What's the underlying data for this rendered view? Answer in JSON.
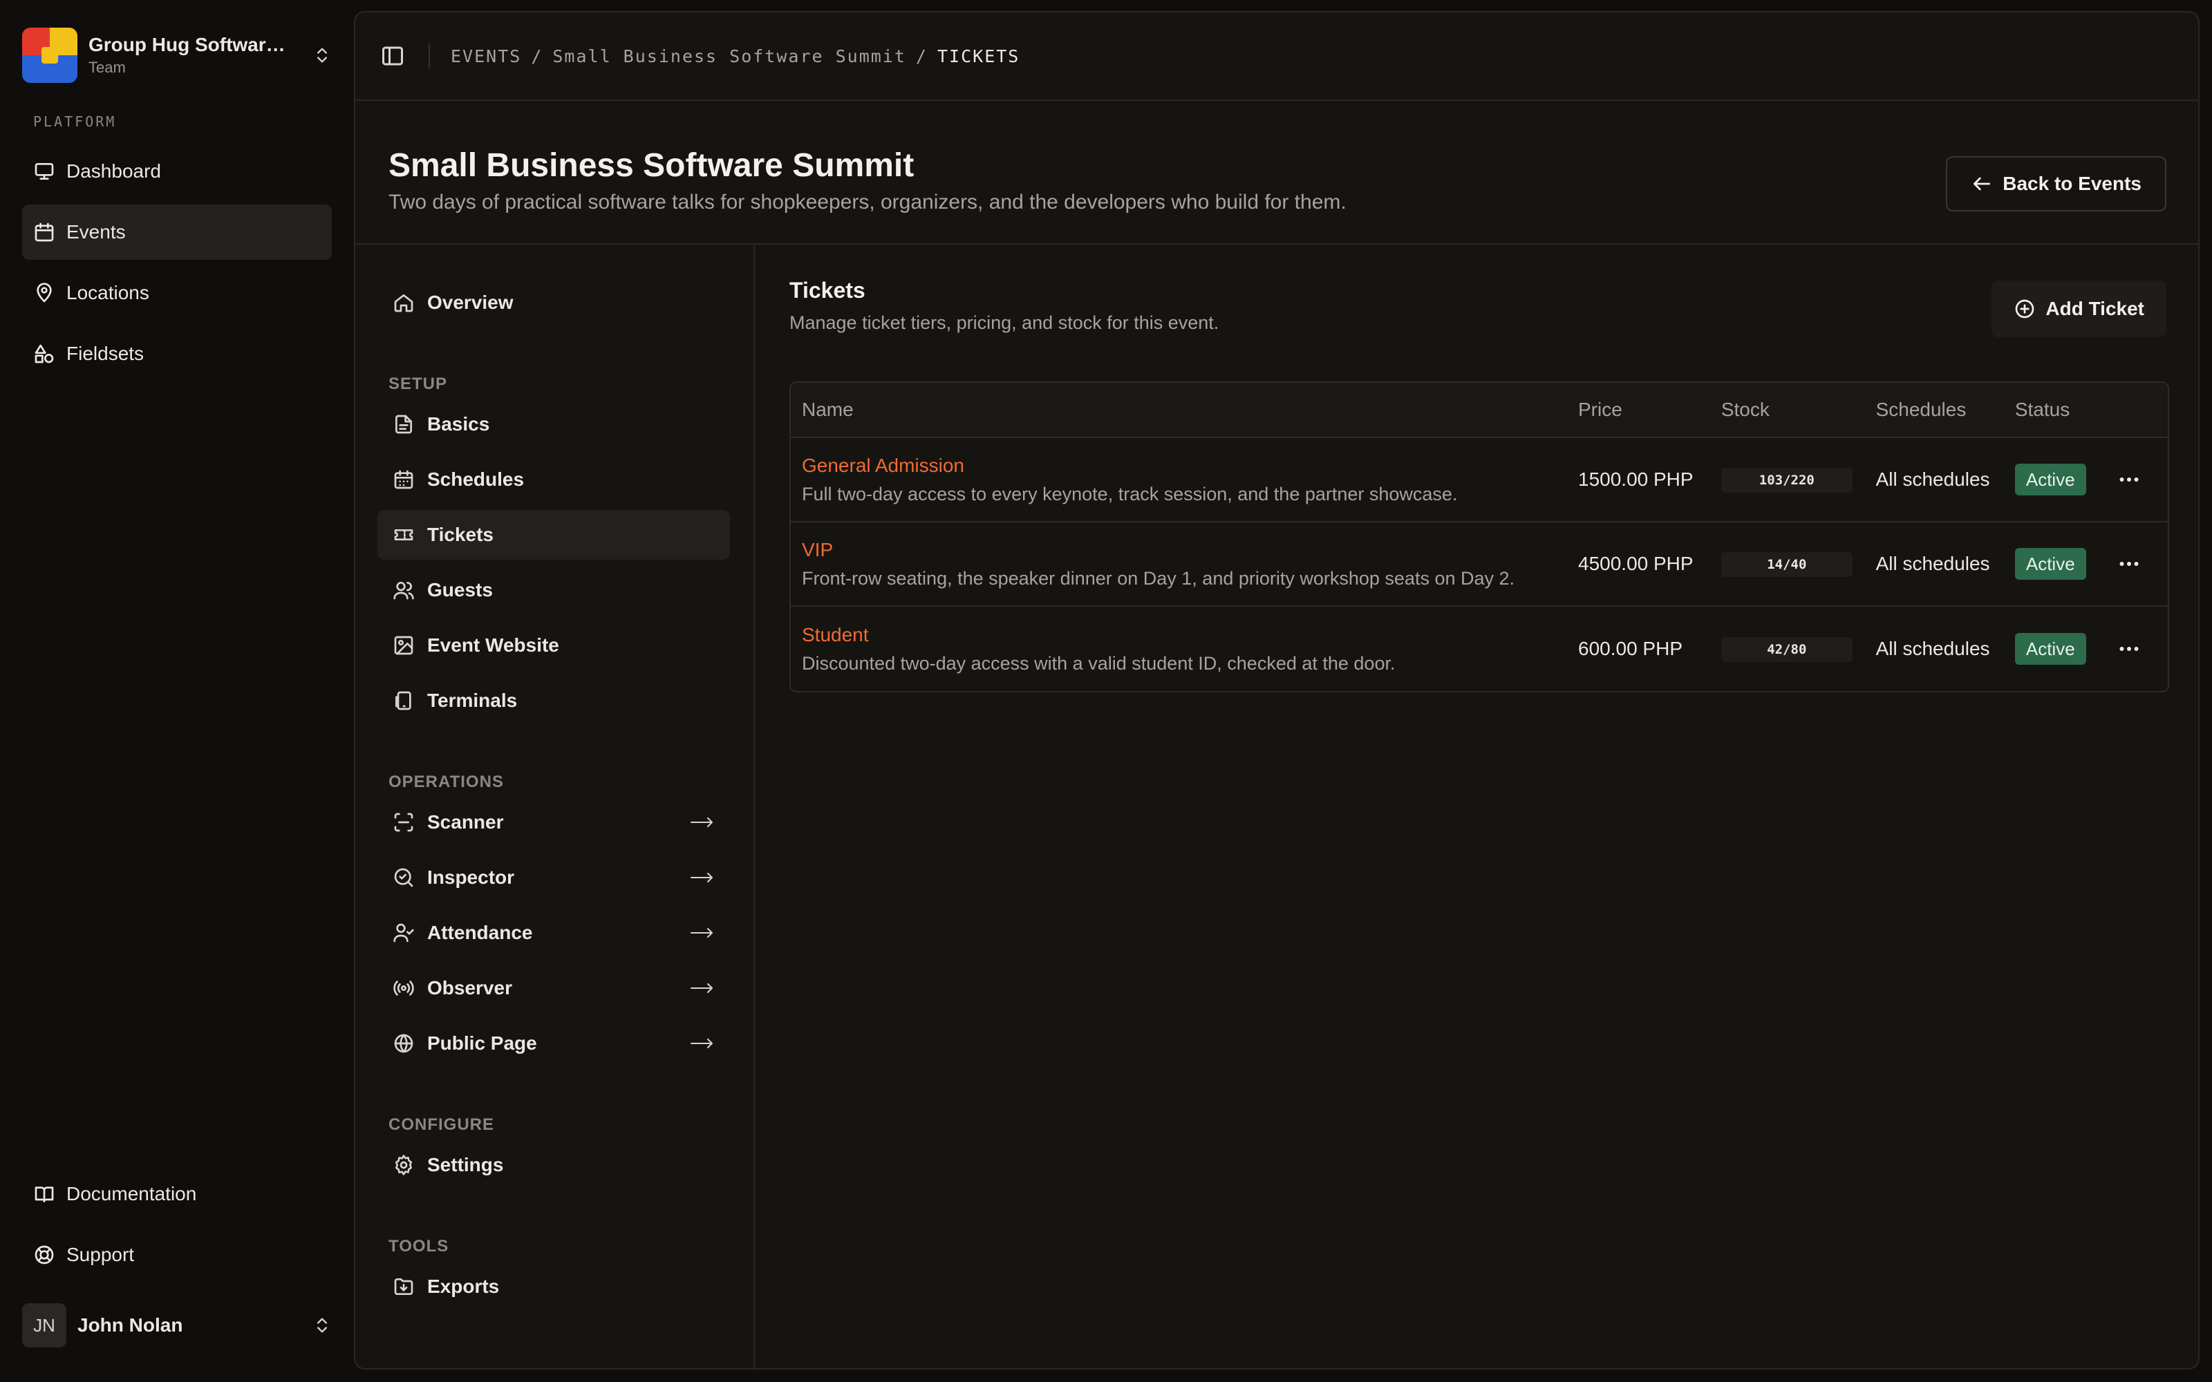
{
  "team": {
    "name": "Group Hug Software...",
    "subtitle": "Team"
  },
  "sidebar": {
    "section_label": "PLATFORM",
    "items": [
      {
        "label": "Dashboard",
        "icon": "monitor-icon"
      },
      {
        "label": "Events",
        "icon": "calendar-icon",
        "active": true
      },
      {
        "label": "Locations",
        "icon": "map-pin-icon"
      },
      {
        "label": "Fieldsets",
        "icon": "shapes-icon"
      }
    ],
    "bottom_items": [
      {
        "label": "Documentation",
        "icon": "book-icon"
      },
      {
        "label": "Support",
        "icon": "life-buoy-icon"
      }
    ]
  },
  "user": {
    "initials": "JN",
    "name": "John Nolan"
  },
  "breadcrumb": {
    "part1": "EVENTS",
    "sep": "/",
    "part2": "Small Business Software Summit",
    "current": "TICKETS"
  },
  "header": {
    "title": "Small Business Software Summit",
    "subtitle": "Two days of practical software talks for shopkeepers, organizers, and the developers who build for them.",
    "back_label": "Back to Events"
  },
  "subnav": {
    "overview": "Overview",
    "setup_label": "SETUP",
    "setup": [
      "Basics",
      "Schedules",
      "Tickets",
      "Guests",
      "Event Website",
      "Terminals"
    ],
    "operations_label": "OPERATIONS",
    "operations": [
      "Scanner",
      "Inspector",
      "Attendance",
      "Observer",
      "Public Page"
    ],
    "configure_label": "CONFIGURE",
    "configure": [
      "Settings"
    ],
    "tools_label": "TOOLS",
    "tools": [
      "Exports"
    ]
  },
  "tickets": {
    "title": "Tickets",
    "description": "Manage ticket tiers, pricing, and stock for this event.",
    "add_label": "Add Ticket",
    "columns": {
      "name": "Name",
      "price": "Price",
      "stock": "Stock",
      "schedules": "Schedules",
      "status": "Status"
    },
    "rows": [
      {
        "name": "General Admission",
        "description": "Full two-day access to every keynote, track session, and the partner showcase.",
        "price": "1500.00 PHP",
        "stock": "103/220",
        "schedules": "All schedules",
        "status": "Active"
      },
      {
        "name": "VIP",
        "description": "Front-row seating, the speaker dinner on Day 1, and priority workshop seats on Day 2.",
        "price": "4500.00 PHP",
        "stock": "14/40",
        "schedules": "All schedules",
        "status": "Active"
      },
      {
        "name": "Student",
        "description": "Discounted two-day access with a valid student ID, checked at the door.",
        "price": "600.00 PHP",
        "stock": "42/80",
        "schedules": "All schedules",
        "status": "Active"
      }
    ]
  },
  "colors": {
    "accent": "#f06a35",
    "status_active": "#2c6b4c",
    "background": "#0f0e0c",
    "panel": "#161411"
  }
}
